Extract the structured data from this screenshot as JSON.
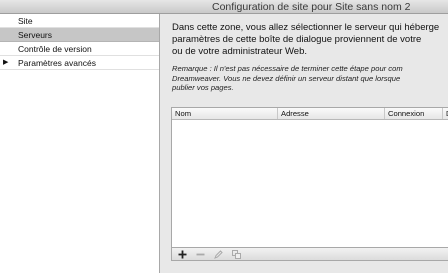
{
  "window": {
    "title": "Configuration de site pour Site sans nom 2"
  },
  "sidebar": {
    "items": [
      {
        "label": "Site",
        "selected": false,
        "expandable": false
      },
      {
        "label": "Serveurs",
        "selected": true,
        "expandable": false
      },
      {
        "label": "Contrôle de version",
        "selected": false,
        "expandable": false
      },
      {
        "label": "Paramètres avancés",
        "selected": false,
        "expandable": true,
        "expander_icon": "triangle-right-icon"
      }
    ]
  },
  "main": {
    "description_lines": [
      "Dans cette zone, vous allez sélectionner le serveur qui héberge",
      "paramètres de cette boîte de dialogue proviennent de votre",
      "ou de votre administrateur Web."
    ],
    "remark_lines": [
      "Remarque : Il n'est pas nécessaire de terminer cette étape pour com",
      "Dreamweaver. Vous ne devez définir un serveur distant que lorsque",
      "publier vos pages."
    ],
    "table": {
      "columns": [
        "Nom",
        "Adresse",
        "Connexion",
        "Di"
      ],
      "rows": []
    },
    "toolbar": {
      "add_icon": "plus-icon",
      "remove_icon": "minus-icon",
      "edit_icon": "pencil-icon",
      "duplicate_icon": "duplicate-icon",
      "add_label": "+",
      "remove_label": "−"
    }
  }
}
